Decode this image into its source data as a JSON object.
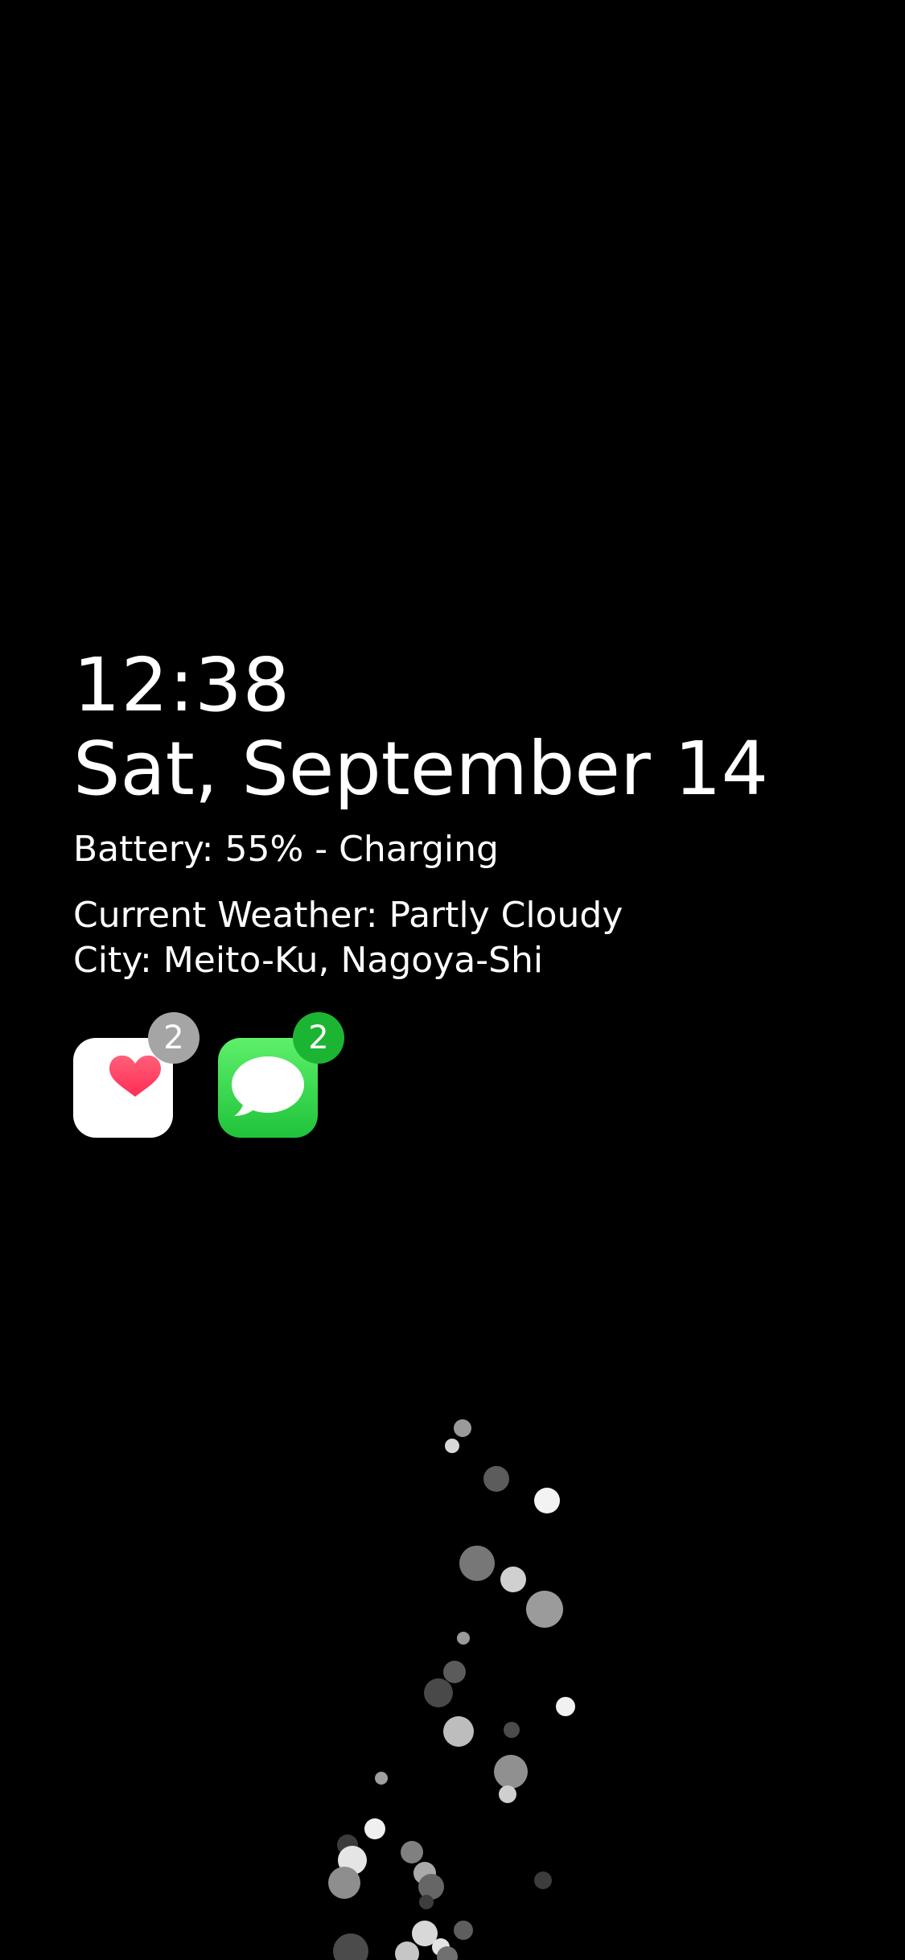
{
  "lock_screen": {
    "time": "12:38",
    "date": "Sat, September 14",
    "battery": "Battery: 55% - Charging",
    "weather": "Current Weather: Partly Cloudy",
    "city": "City: Meito-Ku, Nagoya-Shi"
  },
  "apps": [
    {
      "name": "Health",
      "icon": "heart-icon",
      "badge": "2",
      "badge_color": "#a5a5a5",
      "bg_color": "#ffffff"
    },
    {
      "name": "Messages",
      "icon": "speech-bubble-icon",
      "badge": "2",
      "badge_color": "#1cb533",
      "bg_color": "#2ad74a"
    }
  ],
  "colors": {
    "background": "#000000",
    "text": "#ffffff",
    "heart": "#ff3b5c"
  }
}
